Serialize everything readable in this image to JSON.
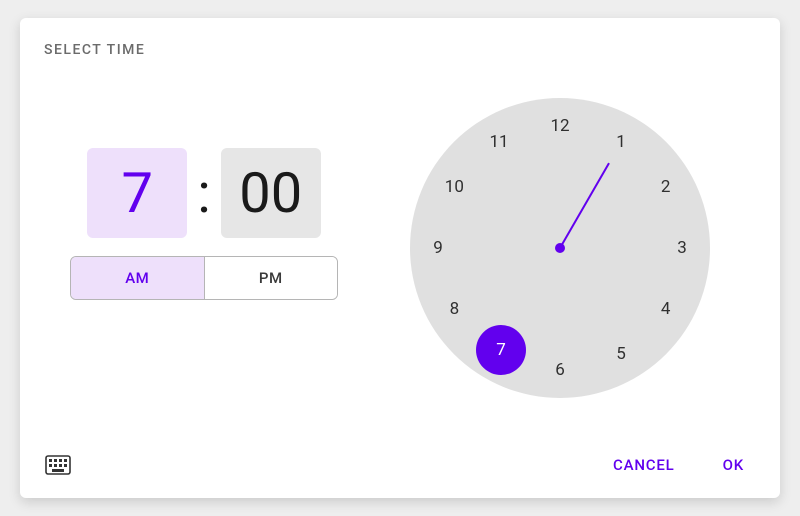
{
  "dialog": {
    "title": "SELECT TIME",
    "actions": {
      "cancel": "CANCEL",
      "ok": "OK"
    }
  },
  "time": {
    "hour": "7",
    "minute": "00",
    "am_label": "AM",
    "pm_label": "PM",
    "period": "AM"
  },
  "clock": {
    "numbers": [
      "12",
      "1",
      "2",
      "3",
      "4",
      "5",
      "6",
      "7",
      "8",
      "9",
      "10",
      "11"
    ],
    "selected_hour": 7,
    "selected_label": "7"
  },
  "colors": {
    "accent": "#6200ee",
    "accent_light": "#eee0fb",
    "surface": "#e6e6e6",
    "clock_bg": "#e0e0e0"
  }
}
